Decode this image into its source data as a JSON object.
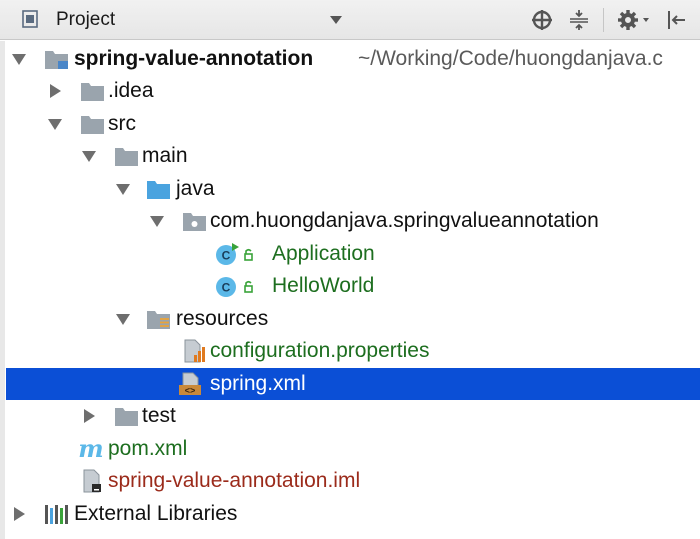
{
  "toolbar": {
    "title": "Project",
    "icons": [
      "project-view-icon",
      "dropdown-chevron-icon",
      "locate-icon",
      "collapse-all-icon",
      "settings-icon",
      "hide-panel-icon"
    ]
  },
  "tree": {
    "root": {
      "label": "spring-value-annotation",
      "path": "~/Working/Code/huongdanjava.c"
    },
    "idea": {
      "label": ".idea"
    },
    "src": {
      "label": "src"
    },
    "main": {
      "label": "main"
    },
    "java": {
      "label": "java"
    },
    "package": {
      "label": "com.huongdanjava.springvalueannotation"
    },
    "application": {
      "label": "Application"
    },
    "helloworld": {
      "label": "HelloWorld"
    },
    "resources": {
      "label": "resources"
    },
    "configuration": {
      "label": "configuration.properties"
    },
    "springxml": {
      "label": "spring.xml"
    },
    "test": {
      "label": "test"
    },
    "pom": {
      "label": "pom.xml"
    },
    "iml": {
      "label": "spring-value-annotation.iml"
    },
    "libraries": {
      "label": "External Libraries"
    }
  },
  "colors": {
    "selection": "#0b4fd6",
    "folder": "#9aa4ad",
    "source_folder": "#4aa3df",
    "class_circle": "#5bb8e8",
    "modified_green": "#1d6e1f",
    "iml_red": "#9b2b1b"
  }
}
